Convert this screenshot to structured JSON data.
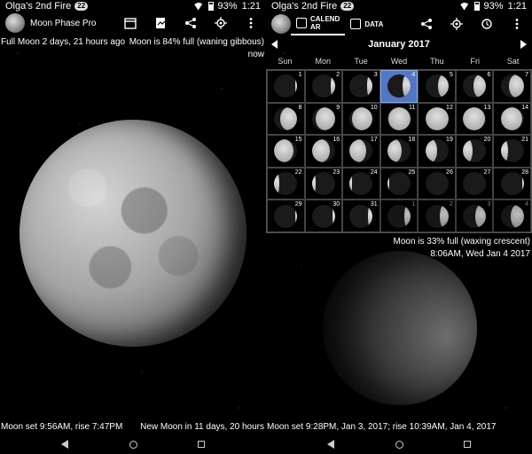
{
  "status": {
    "carrier": "Olga's 2nd Fire",
    "badge": "22",
    "battery": "93%",
    "time": "1:21"
  },
  "left": {
    "app_title": "Moon Phase Pro",
    "top_left": "Full Moon 2 days, 21 hours ago",
    "top_right": "Moon is 84% full (waning gibbous)",
    "top_right2": "now",
    "bottom_left": "Moon set 9:56AM, rise 7:47PM",
    "bottom_right": "New Moon in 11 days, 20 hours"
  },
  "right": {
    "tabs": {
      "calendar": "CALEND\nAR",
      "data": "DATA"
    },
    "month": "January 2017",
    "dow": [
      "Sun",
      "Mon",
      "Tue",
      "Wed",
      "Thu",
      "Fri",
      "Sat"
    ],
    "days": [
      {
        "n": "1",
        "lit": 0.1,
        "side": "r"
      },
      {
        "n": "2",
        "lit": 0.18,
        "side": "r"
      },
      {
        "n": "3",
        "lit": 0.25,
        "side": "r"
      },
      {
        "n": "4",
        "lit": 0.33,
        "side": "r",
        "today": true
      },
      {
        "n": "5",
        "lit": 0.45,
        "side": "r"
      },
      {
        "n": "6",
        "lit": 0.55,
        "side": "r"
      },
      {
        "n": "7",
        "lit": 0.65,
        "side": "r"
      },
      {
        "n": "8",
        "lit": 0.75,
        "side": "r"
      },
      {
        "n": "9",
        "lit": 0.85,
        "side": "r"
      },
      {
        "n": "10",
        "lit": 0.92,
        "side": "r"
      },
      {
        "n": "11",
        "lit": 0.98,
        "side": "r"
      },
      {
        "n": "12",
        "lit": 1.0,
        "side": "r"
      },
      {
        "n": "13",
        "lit": 0.97,
        "side": "l"
      },
      {
        "n": "14",
        "lit": 0.92,
        "side": "l"
      },
      {
        "n": "15",
        "lit": 0.85,
        "side": "l"
      },
      {
        "n": "16",
        "lit": 0.78,
        "side": "l"
      },
      {
        "n": "17",
        "lit": 0.7,
        "side": "l"
      },
      {
        "n": "18",
        "lit": 0.6,
        "side": "l"
      },
      {
        "n": "19",
        "lit": 0.5,
        "side": "l"
      },
      {
        "n": "20",
        "lit": 0.4,
        "side": "l"
      },
      {
        "n": "21",
        "lit": 0.3,
        "side": "l"
      },
      {
        "n": "22",
        "lit": 0.22,
        "side": "l"
      },
      {
        "n": "23",
        "lit": 0.15,
        "side": "l"
      },
      {
        "n": "24",
        "lit": 0.08,
        "side": "l"
      },
      {
        "n": "25",
        "lit": 0.03,
        "side": "l"
      },
      {
        "n": "26",
        "lit": 0.0,
        "side": "l"
      },
      {
        "n": "27",
        "lit": 0.0,
        "side": "l"
      },
      {
        "n": "28",
        "lit": 0.02,
        "side": "r"
      },
      {
        "n": "29",
        "lit": 0.06,
        "side": "r"
      },
      {
        "n": "30",
        "lit": 0.12,
        "side": "r"
      },
      {
        "n": "31",
        "lit": 0.2,
        "side": "r"
      },
      {
        "n": "1",
        "lit": 0.28,
        "side": "r",
        "other": true
      },
      {
        "n": "2",
        "lit": 0.36,
        "side": "r",
        "other": true
      },
      {
        "n": "3",
        "lit": 0.45,
        "side": "r",
        "other": true
      },
      {
        "n": "4",
        "lit": 0.55,
        "side": "r",
        "other": true
      }
    ],
    "info1": "Moon is 33% full (waxing crescent)",
    "info2": "8:06AM, Wed Jan 4 2017",
    "bottom": "Moon set 9:28PM, Jan 3, 2017; rise 10:39AM, Jan 4, 2017"
  }
}
